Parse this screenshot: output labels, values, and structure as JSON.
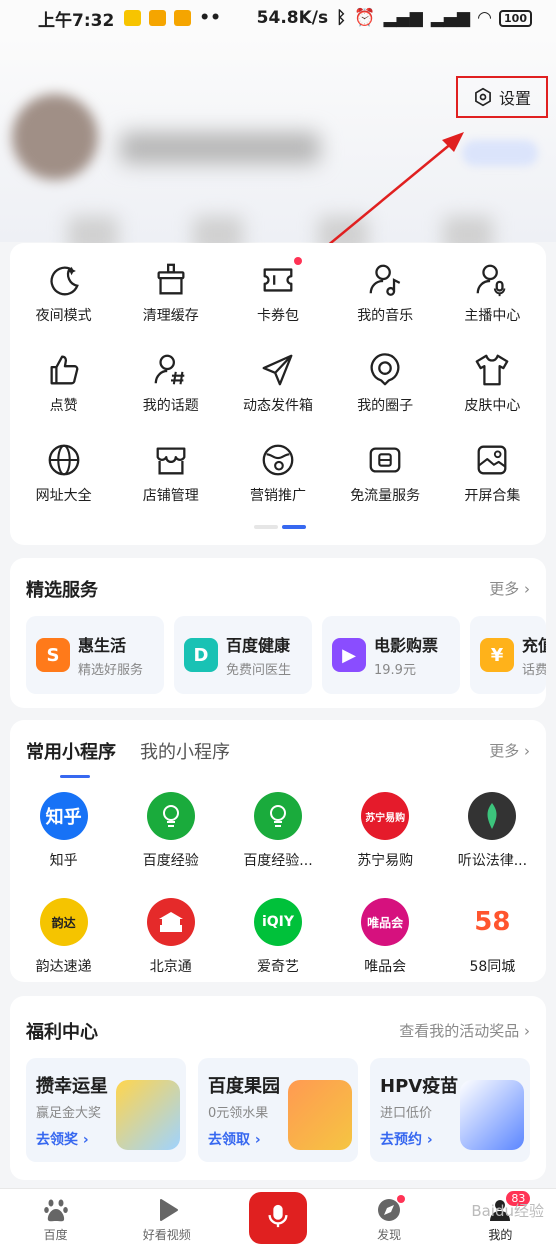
{
  "status": {
    "time": "上午7:32",
    "speed": "54.8K/s",
    "battery": "100"
  },
  "settings": {
    "label": "设置"
  },
  "tools": [
    {
      "label": "夜间模式",
      "icon": "moon-icon"
    },
    {
      "label": "清理缓存",
      "icon": "broom-icon"
    },
    {
      "label": "卡券包",
      "icon": "ticket-icon"
    },
    {
      "label": "我的音乐",
      "icon": "music-user-icon"
    },
    {
      "label": "主播中心",
      "icon": "mic-user-icon"
    },
    {
      "label": "点赞",
      "icon": "thumbs-up-icon"
    },
    {
      "label": "我的话题",
      "icon": "hashtag-user-icon"
    },
    {
      "label": "动态发件箱",
      "icon": "send-icon"
    },
    {
      "label": "我的圈子",
      "icon": "circle-icon"
    },
    {
      "label": "皮肤中心",
      "icon": "tshirt-icon"
    },
    {
      "label": "网址大全",
      "icon": "globe-icon"
    },
    {
      "label": "店铺管理",
      "icon": "store-icon"
    },
    {
      "label": "营销推广",
      "icon": "promo-icon"
    },
    {
      "label": "免流量服务",
      "icon": "sim-icon"
    },
    {
      "label": "开屏合集",
      "icon": "image-icon"
    }
  ],
  "services": {
    "title": "精选服务",
    "more": "更多",
    "items": [
      {
        "name": "惠生活",
        "sub": "精选好服务",
        "color": "#ff7a1a"
      },
      {
        "name": "百度健康",
        "sub": "免费问医生",
        "color": "#19c2b4"
      },
      {
        "name": "电影购票",
        "sub": "19.9元",
        "color": "#8a4dff"
      },
      {
        "name": "充值",
        "sub": "话费",
        "color": "#ffb21a"
      }
    ]
  },
  "miniprograms": {
    "tab_common": "常用小程序",
    "tab_mine": "我的小程序",
    "more": "更多",
    "apps": [
      {
        "label": "知乎",
        "logo": "知乎",
        "color": "#1772f6"
      },
      {
        "label": "百度经验",
        "logo": "",
        "color": "#1aab3c"
      },
      {
        "label": "百度经验...",
        "logo": "",
        "color": "#1aab3c"
      },
      {
        "label": "苏宁易购",
        "logo": "苏宁易购",
        "color": "#e51b2b"
      },
      {
        "label": "听讼法律...",
        "logo": "",
        "color": "#333333"
      },
      {
        "label": "韵达速递",
        "logo": "韵达",
        "color": "#f5c400"
      },
      {
        "label": "北京通",
        "logo": "",
        "color": "#e52a2a"
      },
      {
        "label": "爱奇艺",
        "logo": "iQIY",
        "color": "#00c13a"
      },
      {
        "label": "唯品会",
        "logo": "唯品会",
        "color": "#d6117e"
      },
      {
        "label": "58同城",
        "logo": "58",
        "color": "#ffffff"
      }
    ]
  },
  "welfare": {
    "title": "福利中心",
    "more": "查看我的活动奖品",
    "items": [
      {
        "title": "攒幸运星",
        "sub": "赢足金大奖",
        "action": "去领奖",
        "color": "#9fd3ff"
      },
      {
        "title": "百度果园",
        "sub": "0元领水果",
        "action": "去领取",
        "color": "#ff9a52"
      },
      {
        "title": "HPV疫苗",
        "sub": "进口低价",
        "action": "去预约",
        "color": "#5b86ff"
      }
    ]
  },
  "nav": {
    "home": "百度",
    "video": "好看视频",
    "discover": "发现",
    "mine": "我的",
    "badge": "83",
    "watermark": "Baidu经验"
  }
}
